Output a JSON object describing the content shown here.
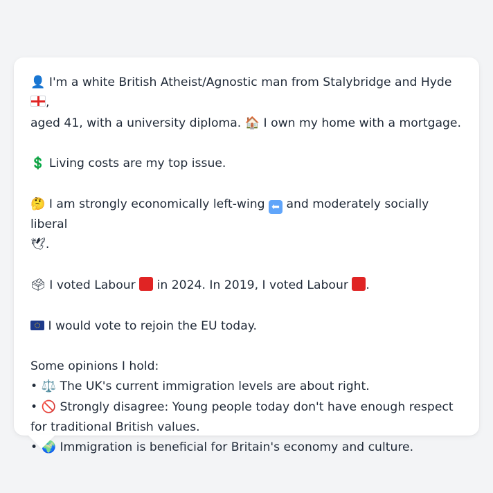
{
  "profile": {
    "line1_icon": "👤",
    "line1_text": " I'm a white British Atheist/Agnostic man from Stalybridge and Hyde ",
    "line1_flag": "england-flag-icon",
    "line1_text2": ",",
    "line2_text": "aged 41, with a university diploma. ",
    "house_icon": "🏠",
    "line2_text2": " I own my home with a mortgage."
  },
  "issue": {
    "icon": "💲",
    "text": " Living costs are my top issue."
  },
  "ideology": {
    "icon": "🤔",
    "text1": " I am strongly economically left-wing ",
    "arrow_icon": "⬅",
    "text2": " and moderately socially liberal",
    "dove_icon": "🕊",
    "text3": "."
  },
  "votes": {
    "icon": "🗳",
    "text1": " I voted Labour ",
    "text2": " in 2024. In 2019, I voted Labour ",
    "text3": "."
  },
  "eu": {
    "flag": "eu-flag-icon",
    "text": " I would vote to rejoin the EU today."
  },
  "opinions": {
    "heading": "Some opinions I hold:",
    "items": [
      {
        "bullet": "• ",
        "icon": "⚖️",
        "text": " The UK's current immigration levels are about right."
      },
      {
        "bullet": "• ",
        "icon": "🚫",
        "text": " Strongly disagree: Young people today don't have enough respect for traditional British values."
      },
      {
        "bullet": "• ",
        "icon": "🌍",
        "text": " Immigration is beneficial for Britain's economy and culture."
      }
    ]
  },
  "colors": {
    "background": "#f3f4f6",
    "bubble": "#ffffff",
    "text": "#1f2937",
    "labour_red": "#e02424"
  }
}
